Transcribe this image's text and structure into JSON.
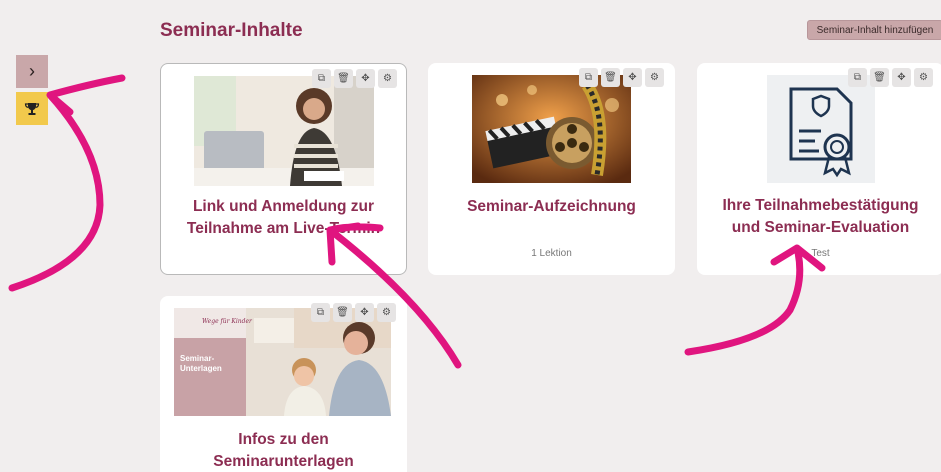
{
  "header": {
    "title": "Seminar-Inhalte",
    "add_button": "Seminar-Inhalt hinzufügen"
  },
  "sidebar": {
    "toggle_glyph": "›",
    "trophy_icon": "trophy-icon"
  },
  "toolbar_icons": [
    "copy-icon",
    "trash-icon",
    "move-icon",
    "settings-icon"
  ],
  "cards": [
    {
      "title": "Link und Anmeldung zur Teilnahme am Live-Termin",
      "meta": ""
    },
    {
      "title": "Seminar-Aufzeichnung",
      "meta": "1 Lektion"
    },
    {
      "title": "Ihre Teilnahmebestätigung und Seminar-Evaluation",
      "meta": "Test"
    },
    {
      "title": "Infos zu den Seminarunterlagen",
      "meta": ""
    }
  ],
  "thumb4": {
    "label": "Seminar-Unterlagen",
    "brand": "Wege für Kinder"
  },
  "colors": {
    "accent": "#8c2d52",
    "button_bg": "#c9a7a9",
    "trophy_bg": "#f2c94c",
    "annotation": "#e0157f"
  }
}
